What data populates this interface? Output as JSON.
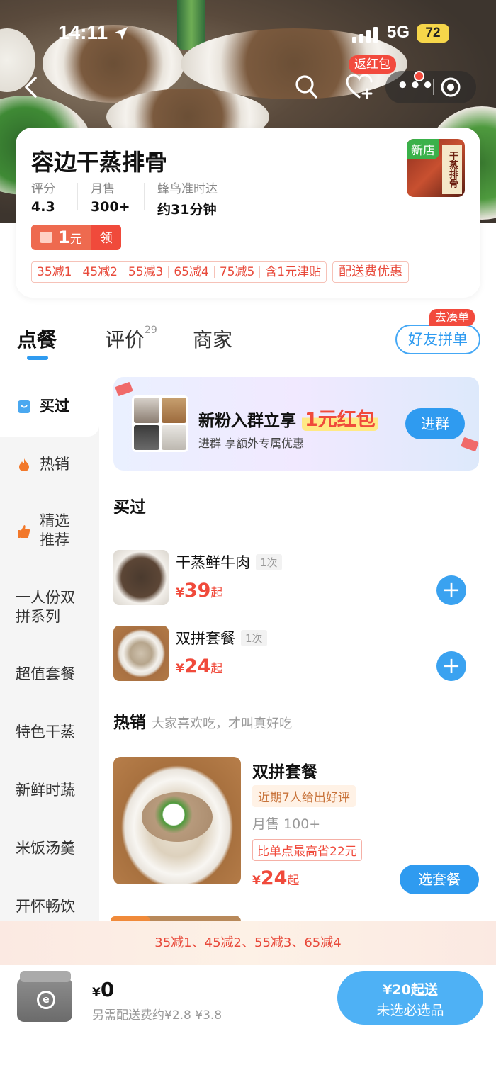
{
  "status_bar": {
    "time": "14:11",
    "network": "5G",
    "battery": "72"
  },
  "header": {
    "hongbao_label": "返红包"
  },
  "store": {
    "name": "容边干蒸排骨",
    "new_badge": "新店",
    "logo_text": "干蒸排骨",
    "stats": [
      {
        "label": "评分",
        "value": "4.3"
      },
      {
        "label": "月售",
        "value": "300+"
      },
      {
        "label": "蜂鸟准时达",
        "value": "约31分钟"
      }
    ],
    "coupon": {
      "amount": "1",
      "unit": "元",
      "action": "领"
    },
    "promos": [
      "35减1",
      "45减2",
      "55减3",
      "65减4",
      "75减5",
      "含1元津贴"
    ],
    "delivery_promo": "配送费优惠"
  },
  "tabs": {
    "order": "点餐",
    "reviews": "评价",
    "reviews_count": "29",
    "merchant": "商家",
    "group_order": "好友拼单",
    "group_tag": "去凑单"
  },
  "sidebar": {
    "items": [
      "买过",
      "热销",
      "精选\n推荐",
      "一人份双\n拼系列",
      "超值套餐",
      "特色干蒸",
      "新鲜时蔬",
      "米饭汤羹",
      "开怀畅饮"
    ]
  },
  "banner": {
    "title_prefix": "新粉入群立享",
    "title_highlight": "1元红包",
    "subtitle": "进群 享额外专属优惠",
    "join_button": "进群"
  },
  "bought_section": {
    "title": "买过",
    "items": [
      {
        "name": "干蒸鲜牛肉",
        "count": "1次",
        "yen": "¥",
        "price": "39",
        "suffix": "起"
      },
      {
        "name": "双拼套餐",
        "count": "1次",
        "yen": "¥",
        "price": "24",
        "suffix": "起"
      }
    ]
  },
  "hot_section": {
    "title": "热销",
    "subtitle": "大家喜欢吃，才叫真好吃",
    "item": {
      "name": "双拼套餐",
      "review_tag": "近期7人给出好评",
      "sales": "月售 100+",
      "save_tag": "比单点最高省22元",
      "yen": "¥",
      "price": "24",
      "suffix": "起",
      "button": "选套餐"
    }
  },
  "discount_bar": "35减1、45减2、55减3、65减4",
  "cart": {
    "yen": "¥",
    "total": "0",
    "fee_text": "另需配送费约¥2.8",
    "fee_original": "¥3.8",
    "checkout_line1": "¥20起送",
    "checkout_line2": "未选必选品"
  }
}
